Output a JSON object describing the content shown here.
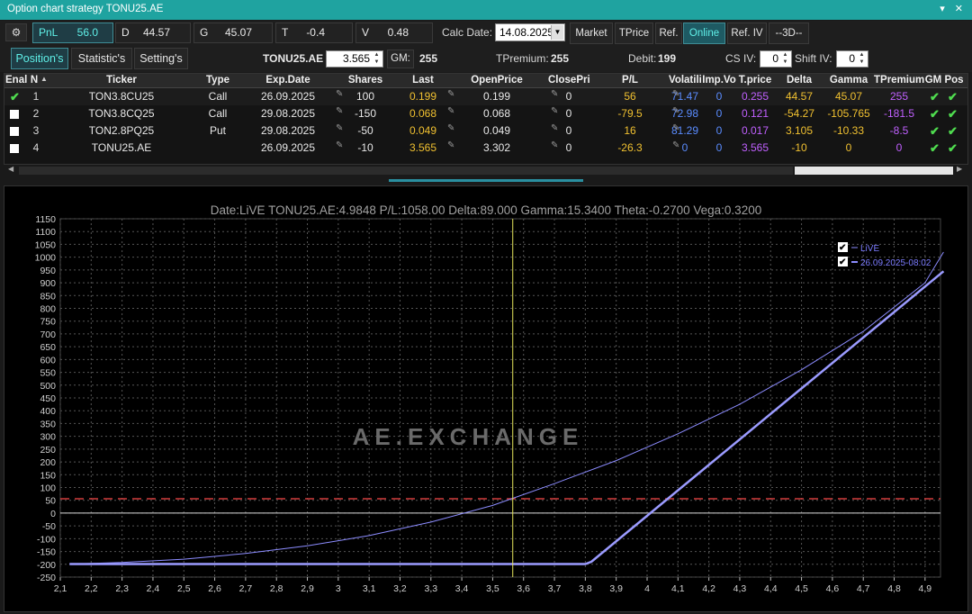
{
  "window": {
    "title": "Option chart strategy TONU25.AE",
    "controls": "▾ ✕"
  },
  "greeks_bar": {
    "pnl": {
      "label": "PnL",
      "value": "56.0"
    },
    "d": {
      "label": "D",
      "value": "44.57"
    },
    "g": {
      "label": "G",
      "value": "45.07"
    },
    "t": {
      "label": "T",
      "value": "-0.4"
    },
    "v": {
      "label": "V",
      "value": "0.48"
    },
    "calc_date_label": "Calc Date:",
    "calc_date_value": "14.08.2025",
    "buttons": [
      "Market",
      "TPrice",
      "Ref.",
      "Online",
      "Ref. IV",
      "--3D--"
    ]
  },
  "tabs": [
    "Position's",
    "Statistic's",
    "Setting's"
  ],
  "summary": {
    "ticker": "TONU25.AE",
    "price": "3.565",
    "gm_label": "GM:",
    "gm_value": "255",
    "tpremium_label": "TPremium:",
    "tpremium_value": "255",
    "debit_label": "Debit:",
    "debit_value": "199",
    "csiv_label": "CS IV:",
    "csiv_value": "0",
    "shiftiv_label": "Shift IV:",
    "shiftiv_value": "0"
  },
  "table": {
    "headers": [
      "Enal",
      "N",
      "Ticker",
      "Type",
      "Exp.Date",
      "Shares",
      "Last",
      "OpenPrice",
      "ClosePri",
      "P/L",
      "Volatili",
      "Imp.Vo",
      "T.price",
      "Delta",
      "Gamma",
      "TPremium",
      "GM",
      "Pos"
    ],
    "rows": [
      {
        "n": "1",
        "ticker": "TON3.8CU25",
        "type": "Call",
        "exp": "26.09.2025",
        "shares": "100",
        "last": "0.199",
        "open": "0.199",
        "close": "0",
        "pl": "56",
        "vol": "71.47",
        "impvol": "0",
        "tprice": "0.255",
        "delta": "44.57",
        "gamma": "45.07",
        "tprem": "255",
        "enabled": true
      },
      {
        "n": "2",
        "ticker": "TON3.8CQ25",
        "type": "Call",
        "exp": "29.08.2025",
        "shares": "-150",
        "last": "0.068",
        "open": "0.068",
        "close": "0",
        "pl": "-79.5",
        "vol": "72.98",
        "impvol": "0",
        "tprice": "0.121",
        "delta": "-54.27",
        "gamma": "-105.765",
        "tprem": "-181.5",
        "enabled": false
      },
      {
        "n": "3",
        "ticker": "TON2.8PQ25",
        "type": "Put",
        "exp": "29.08.2025",
        "shares": "-50",
        "last": "0.049",
        "open": "0.049",
        "close": "0",
        "pl": "16",
        "vol": "81.29",
        "impvol": "0",
        "tprice": "0.017",
        "delta": "3.105",
        "gamma": "-10.33",
        "tprem": "-8.5",
        "enabled": false
      },
      {
        "n": "4",
        "ticker": "TONU25.AE",
        "type": "",
        "exp": "26.09.2025",
        "shares": "-10",
        "last": "3.565",
        "open": "3.302",
        "close": "0",
        "pl": "-26.3",
        "vol": "0",
        "impvol": "0",
        "tprice": "3.565",
        "delta": "-10",
        "gamma": "0",
        "tprem": "0",
        "enabled": false
      }
    ]
  },
  "chart_header": "Date:LiVE  TONU25.AE:4.9848  P/L:1058.00  Delta:89.000  Gamma:15.3400  Theta:-0.2700  Vega:0.3200",
  "watermark": "AE.EXCHANGE",
  "colors": {
    "live": "#8c8cff",
    "expiry": "#9b9bff",
    "cursor": "#e6e65a",
    "breakeven": "#d23c3c",
    "accent": "#5ff0e8"
  },
  "chart_data": {
    "type": "line",
    "xlim": [
      2.1,
      4.95
    ],
    "ylim": [
      -250,
      1150
    ],
    "x_ticks": [
      2.1,
      2.2,
      2.3,
      2.4,
      2.5,
      2.6,
      2.7,
      2.8,
      2.9,
      3,
      3.1,
      3.2,
      3.3,
      3.4,
      3.5,
      3.6,
      3.7,
      3.8,
      3.9,
      4,
      4.1,
      4.2,
      4.3,
      4.4,
      4.5,
      4.6,
      4.7,
      4.8,
      4.9
    ],
    "x_tick_labels": [
      "2,1",
      "2,2",
      "2,3",
      "2,4",
      "2,5",
      "2,6",
      "2,7",
      "2,8",
      "2,9",
      "3",
      "3,1",
      "3,2",
      "3,3",
      "3,4",
      "3,5",
      "3,6",
      "3,7",
      "3,8",
      "3,9",
      "4",
      "4,1",
      "4,2",
      "4,3",
      "4,4",
      "4,5",
      "4,6",
      "4,7",
      "4,8",
      "4,9"
    ],
    "y_ticks": [
      -250,
      -200,
      -150,
      -100,
      -50,
      0,
      50,
      100,
      150,
      200,
      250,
      300,
      350,
      400,
      450,
      500,
      550,
      600,
      650,
      700,
      750,
      800,
      850,
      900,
      950,
      1000,
      1050,
      1100,
      1150
    ],
    "current_price": 3.565,
    "pl_level": 56,
    "zero_level": 0,
    "legend": [
      {
        "name": "LiVE",
        "checked": true
      },
      {
        "name": "26.09.2025-08:02",
        "checked": true
      }
    ],
    "series": [
      {
        "name": "LiVE",
        "x": [
          2.13,
          2.3,
          2.5,
          2.7,
          2.9,
          3.1,
          3.3,
          3.5,
          3.7,
          3.9,
          4.1,
          4.3,
          4.5,
          4.7,
          4.9,
          4.96
        ],
        "y": [
          -199,
          -193,
          -180,
          -158,
          -128,
          -88,
          -35,
          30,
          115,
          205,
          310,
          425,
          560,
          710,
          900,
          1020
        ]
      },
      {
        "name": "26.09.2025-08:02",
        "x": [
          2.13,
          3.8,
          3.82,
          4.96
        ],
        "y": [
          -199,
          -199,
          -190,
          945
        ]
      }
    ]
  }
}
